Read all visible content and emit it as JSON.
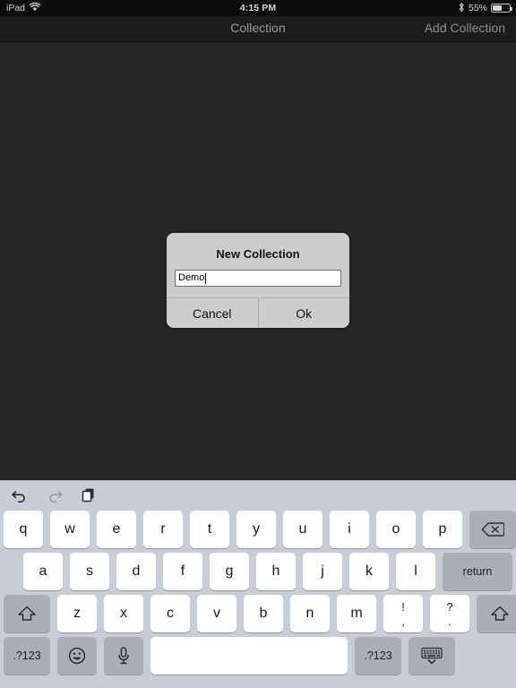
{
  "status_bar": {
    "device": "iPad",
    "wifi_icon": "wifi-icon",
    "time": "4:15 PM",
    "bluetooth_icon": "bluetooth-icon",
    "battery_percent": "55%",
    "battery_level": 55
  },
  "nav_bar": {
    "title": "Collection",
    "add_button": "Add Collection"
  },
  "alert": {
    "title": "New Collection",
    "input_value": "Demo",
    "input_placeholder": "",
    "cancel_label": "Cancel",
    "ok_label": "Ok"
  },
  "keyboard": {
    "toolbar": {
      "undo_icon": "undo-icon",
      "redo_icon": "redo-icon",
      "paste_icon": "paste-icon"
    },
    "row1": [
      "q",
      "w",
      "e",
      "r",
      "t",
      "y",
      "u",
      "i",
      "o",
      "p"
    ],
    "backspace_icon": "backspace-icon",
    "row2": [
      "a",
      "s",
      "d",
      "f",
      "g",
      "h",
      "j",
      "k",
      "l"
    ],
    "return_label": "return",
    "row3": [
      "z",
      "x",
      "c",
      "v",
      "b",
      "n",
      "m"
    ],
    "shift_icon": "shift-icon",
    "punct": [
      {
        "top": "!",
        "bottom": ","
      },
      {
        "top": "?",
        "bottom": "."
      }
    ],
    "numeric_label": ".?123",
    "numeric_label_right": ".?123",
    "emoji_icon": "emoji-icon",
    "mic_icon": "microphone-icon",
    "space_label": "",
    "dismiss_icon": "dismiss-keyboard-icon"
  },
  "colors": {
    "content_bg": "#272727",
    "nav_bg": "#1c1c1c",
    "status_bg": "#0c0c0c",
    "keyboard_bg": "#c9cdd6",
    "key_white": "#ffffff",
    "key_grey": "#a9aeb9",
    "alert_bg": "#cdcdcd"
  }
}
